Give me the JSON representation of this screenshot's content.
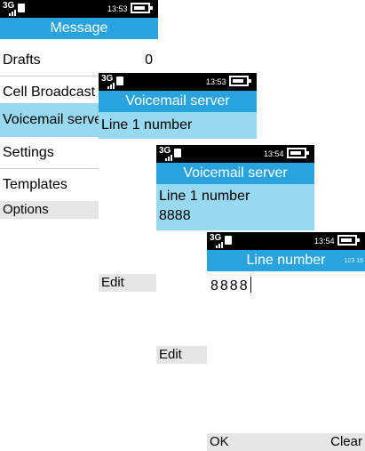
{
  "status": {
    "network": "3G",
    "screen1_time": "13:53",
    "screen2_time": "13:53",
    "screen3_time": "13:54",
    "screen4_time": "13:54"
  },
  "screen1": {
    "title": "Message",
    "items": [
      {
        "label": "Drafts",
        "count": "0"
      },
      {
        "label": "Cell Broadcast"
      },
      {
        "label": "Voicemail server"
      },
      {
        "label": "Settings"
      },
      {
        "label": "Templates"
      }
    ],
    "left_softkey": "Options"
  },
  "screen2": {
    "title": "Voicemail server",
    "item_label": "Line 1 number",
    "left_softkey": "Edit"
  },
  "screen3": {
    "title": "Voicemail server",
    "item_label": "Line 1 number",
    "item_value": "8888",
    "left_softkey": "Edit"
  },
  "screen4": {
    "title": "Line number",
    "input_mode": "123 16",
    "input_value": "8888",
    "left_softkey": "OK",
    "right_softkey": "Clear"
  },
  "colors": {
    "title_bar": "#29a3dd",
    "selection": "#97d9f0",
    "softkey_bar": "#e6e6e6",
    "status_bar": "#000000"
  }
}
